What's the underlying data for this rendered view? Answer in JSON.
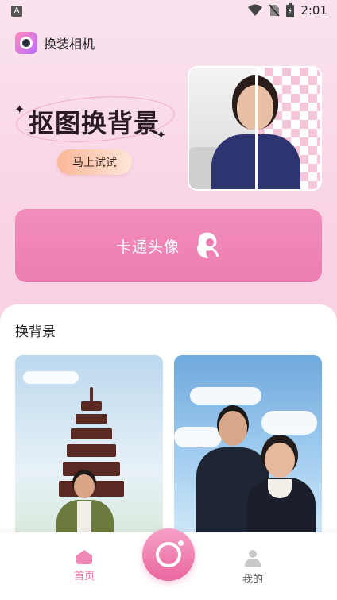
{
  "status_bar": {
    "time": "2:01",
    "left_badge": "A"
  },
  "app": {
    "title": "换装相机"
  },
  "hero": {
    "title": "抠图换背景",
    "try_button": "马上试试"
  },
  "cartoon": {
    "label": "卡通头像"
  },
  "section": {
    "title": "换背景"
  },
  "tabs": [
    {
      "label": "首页",
      "icon": "home-icon",
      "active": true
    },
    {
      "label": "我的",
      "icon": "user-icon",
      "active": false
    }
  ],
  "colors": {
    "accent": "#ee6fa6",
    "cartoon_bg": "#ec7eb1",
    "background": "#f8d2e4"
  }
}
